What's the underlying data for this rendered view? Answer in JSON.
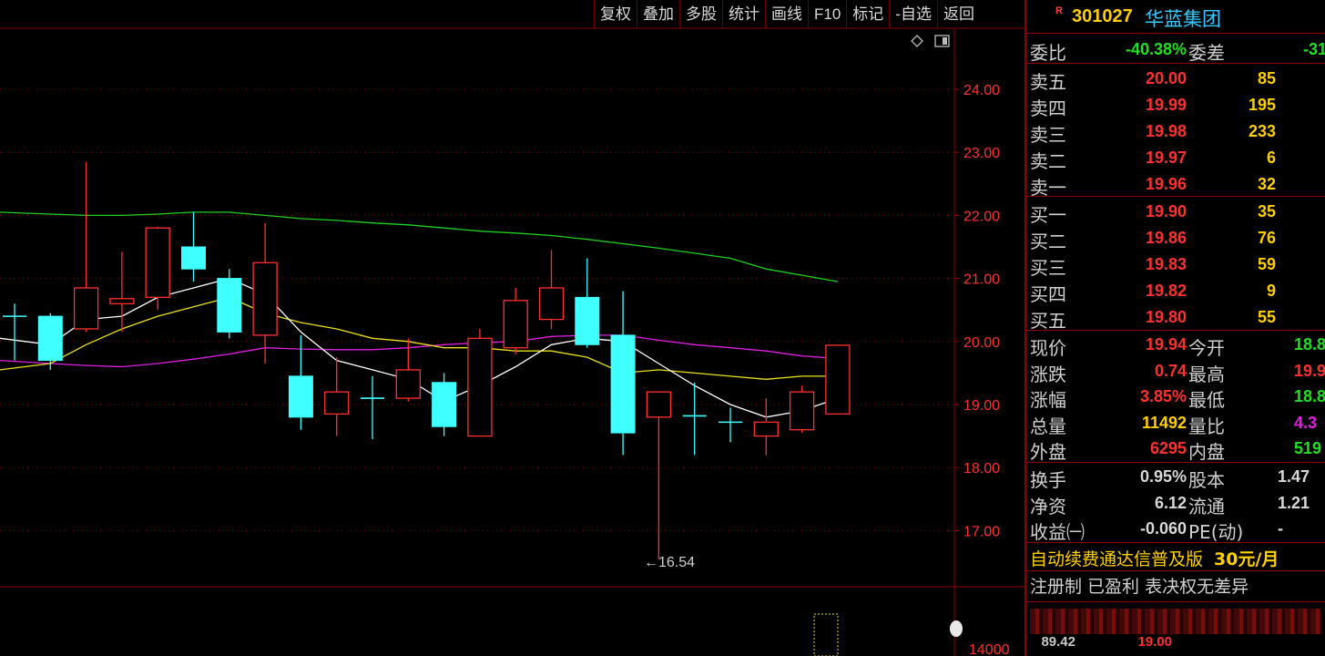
{
  "toolbar": {
    "items": [
      "复权",
      "叠加",
      "多股",
      "统计",
      "画线",
      "F10",
      "标记",
      "-自选",
      "返回"
    ]
  },
  "chart": {
    "price_axis": [
      "24.00",
      "23.00",
      "22.00",
      "21.00",
      "20.00",
      "19.00",
      "18.00",
      "17.00"
    ],
    "low_annotation": "←16.54",
    "volume_axis_label": "14000",
    "colors": {
      "up": "#ff3030",
      "down": "#40ffff",
      "ma5": "#ffffff",
      "ma10": "#e8e020",
      "ma20": "#e020e0",
      "ma60": "#20d020",
      "grid": "#8b0000"
    }
  },
  "chart_data": {
    "type": "candlestick",
    "ylim": [
      16.2,
      24.6
    ],
    "candles": [
      {
        "o": 20.4,
        "c": 20.4,
        "h": 20.6,
        "l": 19.7
      },
      {
        "o": 20.4,
        "c": 19.7,
        "h": 20.45,
        "l": 19.55
      },
      {
        "o": 20.2,
        "c": 20.85,
        "h": 22.85,
        "l": 20.15
      },
      {
        "o": 20.6,
        "c": 20.68,
        "h": 21.42,
        "l": 20.15
      },
      {
        "o": 20.7,
        "c": 21.8,
        "h": 21.82,
        "l": 20.5
      },
      {
        "o": 21.5,
        "c": 21.15,
        "h": 22.05,
        "l": 20.95
      },
      {
        "o": 21.0,
        "c": 20.15,
        "h": 21.15,
        "l": 20.05
      },
      {
        "o": 20.1,
        "c": 21.25,
        "h": 21.88,
        "l": 19.65
      },
      {
        "o": 19.45,
        "c": 18.8,
        "h": 20.1,
        "l": 18.6
      },
      {
        "o": 18.85,
        "c": 19.2,
        "h": 19.75,
        "l": 18.5
      },
      {
        "o": 19.1,
        "c": 19.1,
        "h": 19.45,
        "l": 18.45
      },
      {
        "o": 19.1,
        "c": 19.55,
        "h": 20.05,
        "l": 19.05
      },
      {
        "o": 19.35,
        "c": 18.65,
        "h": 19.5,
        "l": 18.5
      },
      {
        "o": 18.5,
        "c": 20.05,
        "h": 20.2,
        "l": 18.5
      },
      {
        "o": 19.9,
        "c": 20.65,
        "h": 20.85,
        "l": 19.8
      },
      {
        "o": 20.35,
        "c": 20.85,
        "h": 21.45,
        "l": 20.2
      },
      {
        "o": 20.7,
        "c": 19.95,
        "h": 21.32,
        "l": 19.9
      },
      {
        "o": 20.1,
        "c": 18.55,
        "h": 20.8,
        "l": 18.2
      },
      {
        "o": 18.8,
        "c": 19.2,
        "h": 19.2,
        "l": 16.54
      },
      {
        "o": 18.82,
        "c": 18.82,
        "h": 19.35,
        "l": 18.2
      },
      {
        "o": 18.72,
        "c": 18.72,
        "h": 18.95,
        "l": 18.4
      },
      {
        "o": 18.5,
        "c": 18.72,
        "h": 19.1,
        "l": 18.2
      },
      {
        "o": 18.6,
        "c": 19.2,
        "h": 19.3,
        "l": 18.55
      },
      {
        "o": 18.85,
        "c": 19.94,
        "h": 19.95,
        "l": 18.85
      }
    ],
    "ma5": [
      20.05,
      19.95,
      20.35,
      20.4,
      20.7,
      20.85,
      21.0,
      20.75,
      20.15,
      19.7,
      19.55,
      19.4,
      19.05,
      19.3,
      19.6,
      19.95,
      20.05,
      20.0,
      19.65,
      19.3,
      19.0,
      18.8,
      18.9,
      19.1
    ],
    "ma10": [
      19.55,
      19.65,
      19.95,
      20.2,
      20.4,
      20.55,
      20.7,
      20.45,
      20.3,
      20.2,
      20.05,
      20.0,
      19.9,
      19.9,
      19.85,
      19.85,
      19.75,
      19.5,
      19.55,
      19.5,
      19.45,
      19.4,
      19.45,
      19.45
    ],
    "ma20": [
      19.7,
      19.65,
      19.62,
      19.6,
      19.65,
      19.72,
      19.8,
      19.9,
      19.88,
      19.87,
      19.87,
      19.9,
      19.95,
      19.98,
      20.0,
      20.08,
      20.1,
      20.1,
      20.02,
      19.95,
      19.9,
      19.85,
      19.77,
      19.73
    ],
    "ma60": [
      22.05,
      22.02,
      22.0,
      22.0,
      22.02,
      22.05,
      22.05,
      22.0,
      21.95,
      21.92,
      21.88,
      21.85,
      21.8,
      21.75,
      21.72,
      21.68,
      21.62,
      21.55,
      21.48,
      21.4,
      21.32,
      21.15,
      21.05,
      20.95
    ]
  },
  "panel": {
    "stock": {
      "tag": "R",
      "code": "301027",
      "name": "华蓝集团"
    },
    "weibi": {
      "label1": "委比",
      "value1": "-40.38%",
      "label2": "委差",
      "value2": "-31"
    },
    "sell": [
      {
        "label": "卖五",
        "price": "20.00",
        "vol": "85"
      },
      {
        "label": "卖四",
        "price": "19.99",
        "vol": "195"
      },
      {
        "label": "卖三",
        "price": "19.98",
        "vol": "233"
      },
      {
        "label": "卖二",
        "price": "19.97",
        "vol": "6"
      },
      {
        "label": "卖一",
        "price": "19.96",
        "vol": "32"
      }
    ],
    "buy": [
      {
        "label": "买一",
        "price": "19.90",
        "vol": "35"
      },
      {
        "label": "买二",
        "price": "19.86",
        "vol": "76"
      },
      {
        "label": "买三",
        "price": "19.83",
        "vol": "59"
      },
      {
        "label": "买四",
        "price": "19.82",
        "vol": "9"
      },
      {
        "label": "买五",
        "price": "19.80",
        "vol": "55"
      }
    ],
    "quote": [
      {
        "l1": "现价",
        "v1": "19.94",
        "c1": "#ff3030",
        "l2": "今开",
        "v2": "18.8",
        "c2": "#20e020"
      },
      {
        "l1": "涨跌",
        "v1": "0.74",
        "c1": "#ff3030",
        "l2": "最高",
        "v2": "19.9",
        "c2": "#ff3030"
      },
      {
        "l1": "涨幅",
        "v1": "3.85%",
        "c1": "#ff3030",
        "l2": "最低",
        "v2": "18.8",
        "c2": "#20e020"
      },
      {
        "l1": "总量",
        "v1": "11492",
        "c1": "#ffd000",
        "l2": "量比",
        "v2": "4.3",
        "c2": "#e020e0"
      },
      {
        "l1": "外盘",
        "v1": "6295",
        "c1": "#ff3030",
        "l2": "内盘",
        "v2": "519",
        "c2": "#20e020"
      }
    ],
    "fund": [
      {
        "l1": "换手",
        "v1": "0.95%",
        "l2": "股本",
        "v2": "1.47"
      },
      {
        "l1": "净资",
        "v1": "6.12",
        "l2": "流通",
        "v2": "1.21"
      },
      {
        "l1": "收益㈠",
        "v1": "-0.060",
        "l2": "PE(动)",
        "v2": "-"
      }
    ],
    "ad": {
      "text": "自动续费通达信普及版",
      "price": "30元/月"
    },
    "reg": "注册制 已盈利 表决权无差异",
    "bottom": {
      "v1": "89.42",
      "v2": "19.00"
    }
  }
}
